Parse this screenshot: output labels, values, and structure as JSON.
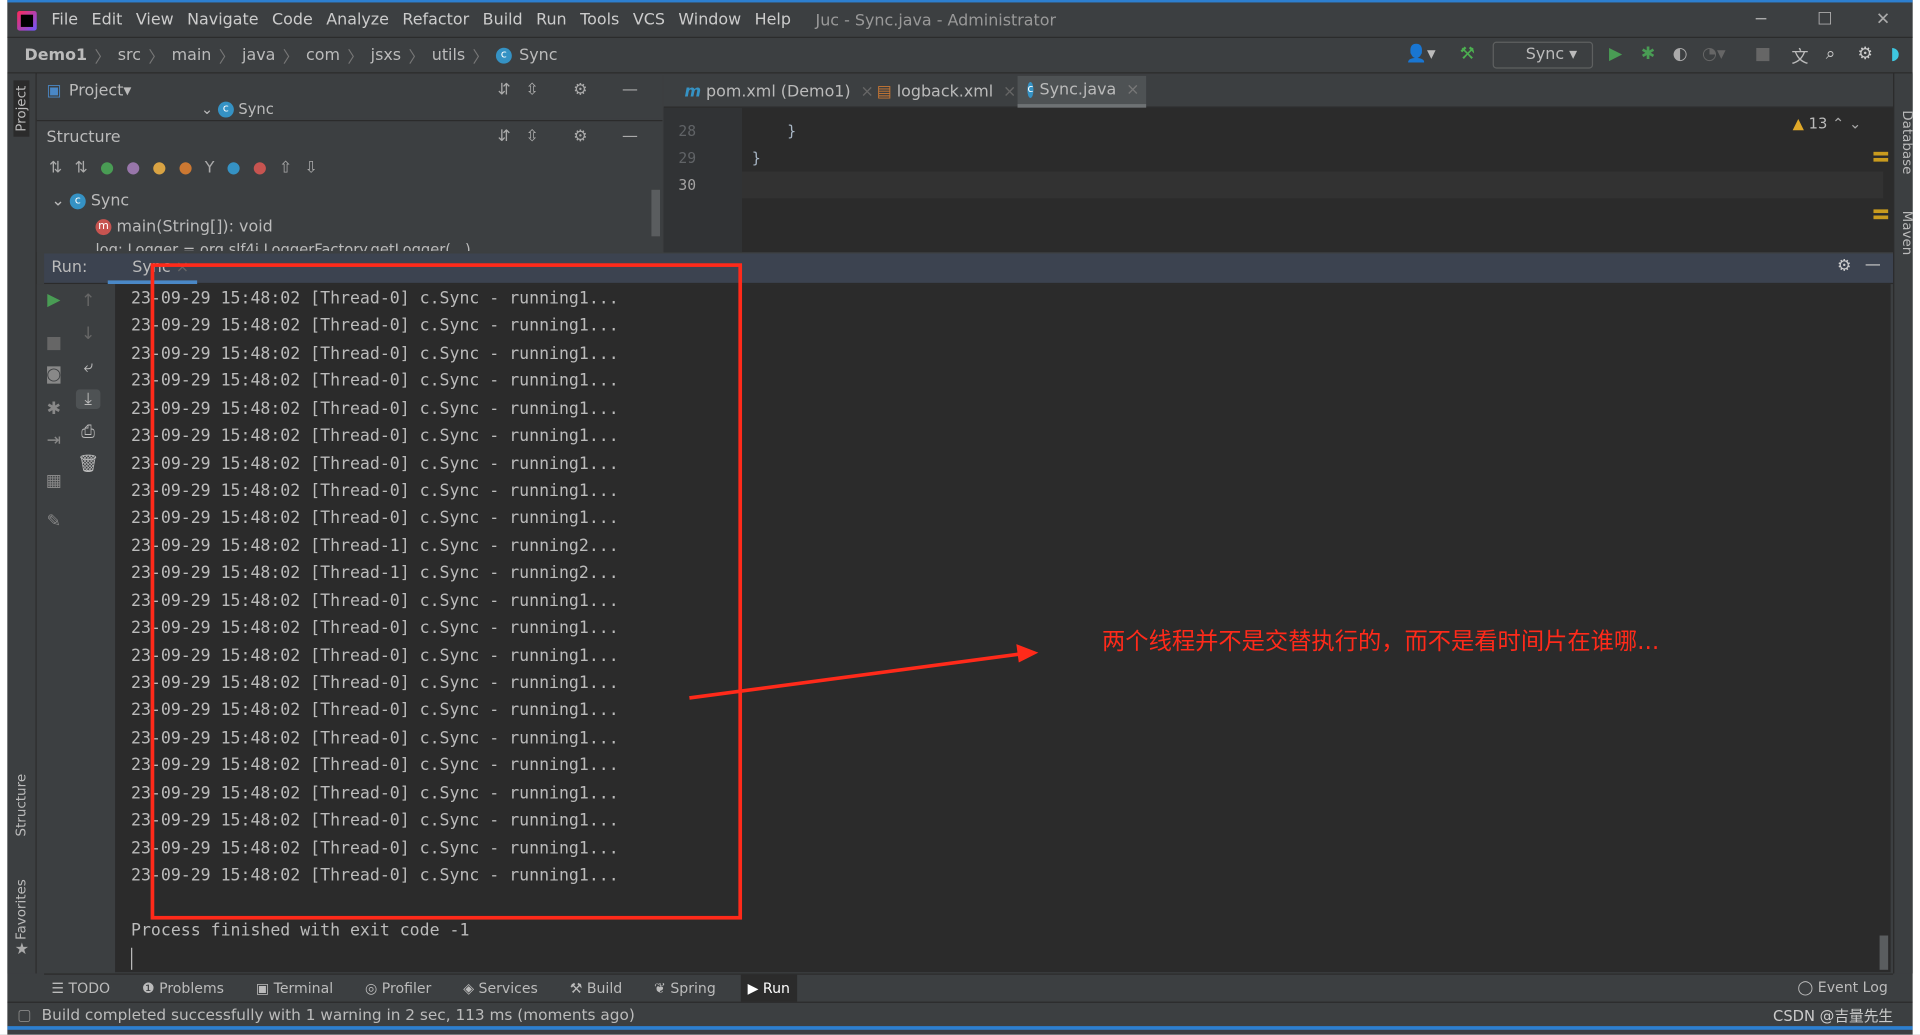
{
  "window": {
    "title": "Juc - Sync.java - Administrator",
    "minimize": "─",
    "maximize": "☐",
    "close": "✕"
  },
  "menu": [
    "File",
    "Edit",
    "View",
    "Navigate",
    "Code",
    "Analyze",
    "Refactor",
    "Build",
    "Run",
    "Tools",
    "VCS",
    "Window",
    "Help"
  ],
  "breadcrumb": [
    "Demo1",
    "src",
    "main",
    "java",
    "com",
    "jsxs",
    "utils",
    "Sync"
  ],
  "toolbar": {
    "run_config": "Sync"
  },
  "project_panel": {
    "title": "Project",
    "tree_item": "Sync"
  },
  "structure_panel": {
    "title": "Structure",
    "class": "Sync",
    "members": [
      "main(String[]): void",
      "log: Logger = org.slf4j.LoggerFactory.getLogger(...)"
    ]
  },
  "editor": {
    "tabs": [
      {
        "label": "pom.xml (Demo1)",
        "active": false
      },
      {
        "label": "logback.xml",
        "active": false
      },
      {
        "label": "Sync.java",
        "active": true
      }
    ],
    "lines": [
      {
        "num": "28",
        "code": "    }"
      },
      {
        "num": "29",
        "code": "}"
      },
      {
        "num": "30",
        "code": ""
      }
    ],
    "warnings": "13"
  },
  "run": {
    "label": "Run:",
    "tab": "Sync",
    "output": [
      "23-09-29 15:48:02 [Thread-0] c.Sync - running1...",
      "23-09-29 15:48:02 [Thread-0] c.Sync - running1...",
      "23-09-29 15:48:02 [Thread-0] c.Sync - running1...",
      "23-09-29 15:48:02 [Thread-0] c.Sync - running1...",
      "23-09-29 15:48:02 [Thread-0] c.Sync - running1...",
      "23-09-29 15:48:02 [Thread-0] c.Sync - running1...",
      "23-09-29 15:48:02 [Thread-0] c.Sync - running1...",
      "23-09-29 15:48:02 [Thread-0] c.Sync - running1...",
      "23-09-29 15:48:02 [Thread-0] c.Sync - running1...",
      "23-09-29 15:48:02 [Thread-1] c.Sync - running2...",
      "23-09-29 15:48:02 [Thread-1] c.Sync - running2...",
      "23-09-29 15:48:02 [Thread-0] c.Sync - running1...",
      "23-09-29 15:48:02 [Thread-0] c.Sync - running1...",
      "23-09-29 15:48:02 [Thread-0] c.Sync - running1...",
      "23-09-29 15:48:02 [Thread-0] c.Sync - running1...",
      "23-09-29 15:48:02 [Thread-0] c.Sync - running1...",
      "23-09-29 15:48:02 [Thread-0] c.Sync - running1...",
      "23-09-29 15:48:02 [Thread-0] c.Sync - running1...",
      "23-09-29 15:48:02 [Thread-0] c.Sync - running1...",
      "23-09-29 15:48:02 [Thread-0] c.Sync - running1...",
      "23-09-29 15:48:02 [Thread-0] c.Sync - running1...",
      "23-09-29 15:48:02 [Thread-0] c.Sync - running1..."
    ],
    "exit": "Process finished with exit code -1"
  },
  "annotation": {
    "text": "两个线程并不是交替执行的，而不是看时间片在谁哪...",
    "color": "#ff2a1a"
  },
  "side_tabs": {
    "left": [
      "Project",
      "Structure",
      "Favorites"
    ],
    "right": [
      "Database",
      "Maven"
    ]
  },
  "bottom_tabs": [
    "TODO",
    "Problems",
    "Terminal",
    "Profiler",
    "Services",
    "Build",
    "Spring",
    "Run"
  ],
  "event_log": "Event Log",
  "status": "Build completed successfully with 1 warning in 2 sec, 113 ms (moments ago)",
  "watermark": "CSDN @吉量先生"
}
